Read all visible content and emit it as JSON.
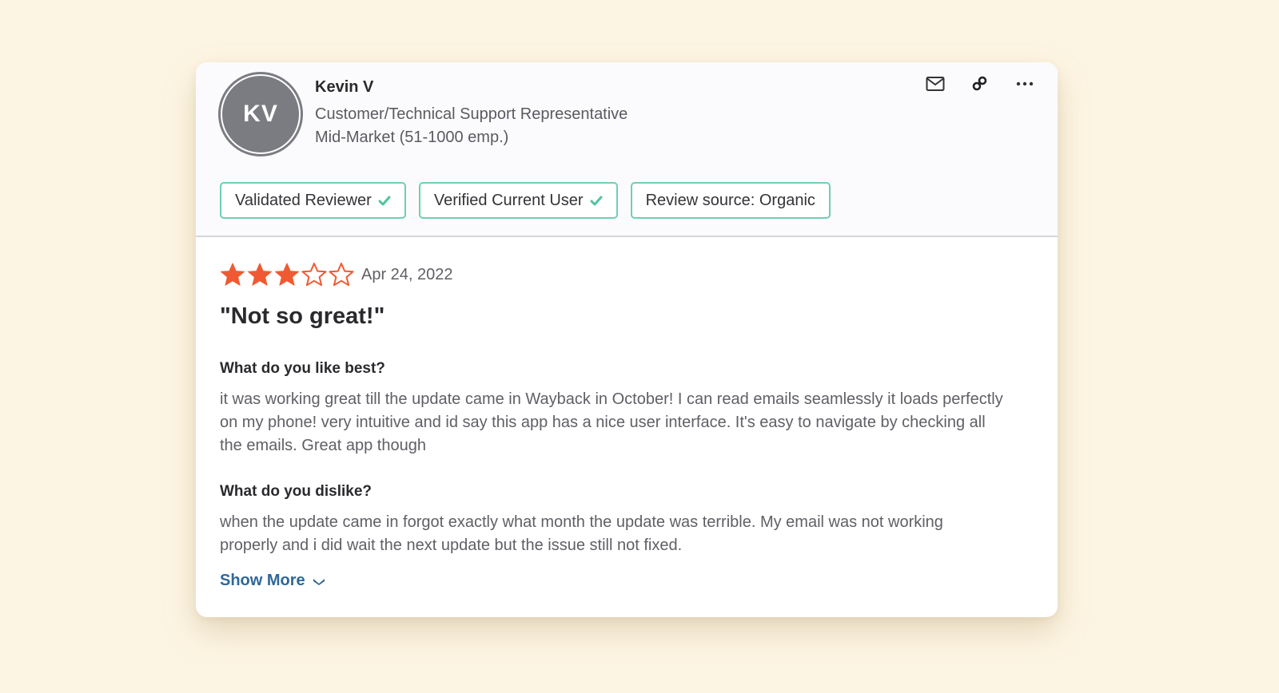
{
  "reviewer": {
    "initials": "KV",
    "name": "Kevin V",
    "role": "Customer/Technical Support Representative",
    "segment": "Mid-Market (51-1000 emp.)"
  },
  "actions": [
    {
      "name": "email",
      "icon": "envelope-icon"
    },
    {
      "name": "link",
      "icon": "link-icon"
    },
    {
      "name": "more",
      "icon": "more-horizontal-icon"
    }
  ],
  "badges": [
    {
      "label": "Validated Reviewer",
      "checked": true
    },
    {
      "label": "Verified Current User",
      "checked": true
    },
    {
      "label": "Review source: Organic",
      "checked": false
    }
  ],
  "review": {
    "rating": 3,
    "rating_max": 5,
    "date": "Apr 24, 2022",
    "title": "\"Not so great!\"",
    "questions": [
      {
        "question": "What do you like best?",
        "answer": "it was working great till the update came in Wayback in October! I can read emails seamlessly it loads perfectly on my phone! very intuitive and id say this app has a nice user interface. It's easy to navigate by checking all the emails. Great app though"
      },
      {
        "question": "What do you dislike?",
        "answer": "when the update came in forgot exactly what month the update was terrible. My email was not working properly and i did wait the next update but the issue still not fixed."
      }
    ],
    "show_more_label": "Show More"
  },
  "colors": {
    "background": "#fdf5e3",
    "star": "#f05a32",
    "badge_border": "#6ecfb4",
    "check": "#4fc3a1",
    "link": "#2f6798",
    "avatar": "#7b7b82"
  }
}
